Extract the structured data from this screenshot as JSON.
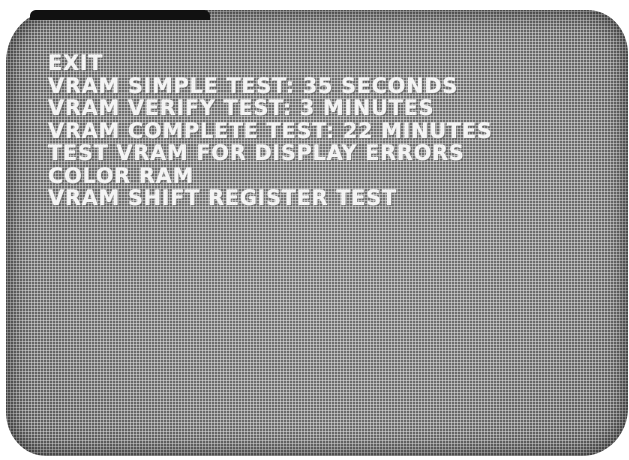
{
  "menu": {
    "items": [
      {
        "label": "EXIT"
      },
      {
        "label": "VRAM SIMPLE TEST: 35 SECONDS"
      },
      {
        "label": "VRAM VERIFY TEST: 3 MINUTES"
      },
      {
        "label": "VRAM COMPLETE TEST: 22 MINUTES"
      },
      {
        "label": "TEST VRAM FOR DISPLAY ERRORS"
      },
      {
        "label": "COLOR RAM"
      },
      {
        "label": "VRAM SHIFT REGISTER TEST"
      }
    ]
  },
  "colors": {
    "screen_background": "#8f8f8f",
    "text": "#f4f4f4",
    "bezel": "#111111"
  }
}
